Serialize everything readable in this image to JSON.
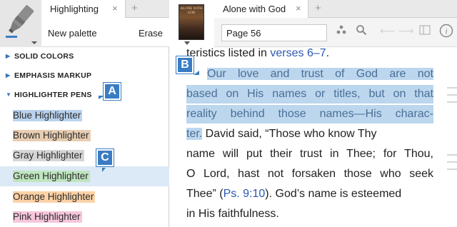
{
  "left_panel": {
    "tab": {
      "label": "Highlighting",
      "close": "×"
    },
    "tab_add": "+",
    "toolbar": {
      "new_palette": "New palette",
      "erase": "Erase"
    },
    "sections": [
      {
        "label": "SOLID COLORS",
        "expanded": false
      },
      {
        "label": "EMPHASIS MARKUP",
        "expanded": false
      },
      {
        "label": "HIGHLIGHTER PENS",
        "expanded": true
      }
    ],
    "highlighters": [
      {
        "label": "Blue Highlighter",
        "color": "#b9d3ee"
      },
      {
        "label": "Brown Highlighter",
        "color": "#e8cdb2"
      },
      {
        "label": "Gray Highlighter",
        "color": "#d6d6d6"
      },
      {
        "label": "Green Highlighter",
        "color": "#bfe5bf"
      },
      {
        "label": "Orange Highlighter",
        "color": "#fbd2a6"
      },
      {
        "label": "Pink Highlighter",
        "color": "#f7c6dc"
      }
    ],
    "selected_index": 3
  },
  "callouts": {
    "a": "A",
    "b": "B",
    "c": "C"
  },
  "right_panel": {
    "tab": {
      "label": "Alone with God",
      "close": "×"
    },
    "tab_add": "+",
    "cover_title": "ALONE WITH GOD",
    "page_field": {
      "value": "Page 56"
    },
    "icons": {
      "info": "i"
    },
    "reader": {
      "line1": {
        "before": "teristics listed in ",
        "link": "verses 6–7",
        "after": "."
      },
      "line2": "Our love and trust of God are not",
      "line3": "based on His names or titles, but on that",
      "line4": "reality behind those names—His charac-",
      "line5": {
        "highlight": "ter.",
        "after": " David said, “Those who know Thy"
      },
      "line6": "name will put their trust in Thee; for Thou,",
      "line7": "O Lord, hast not forsaken those who seek",
      "line8": {
        "before": "Thee” (",
        "link": "Ps. 9:10",
        "after": "). God’s name is esteemed"
      },
      "line9": "in His faithfulness."
    }
  },
  "colors": {
    "accent": "#3a7cc4",
    "selection": "#dce9f6",
    "highlight": "#bcd6ee",
    "link": "#2d57b0"
  }
}
